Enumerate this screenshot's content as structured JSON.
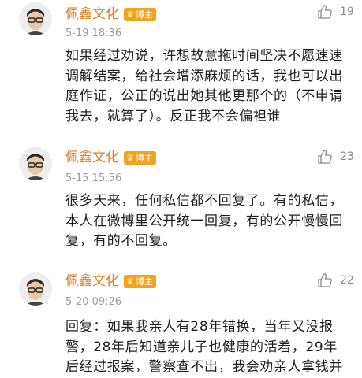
{
  "comments": [
    {
      "username": "佩鑫文化",
      "badge": "博主",
      "time": "5-19 18:36",
      "likes": "19",
      "lines": [
        "如果经过劝说，许想故意拖时间坚决不愿速速",
        "调解结案，给社会增添麻烦的话，我也可以出",
        "庭作证，公正的说出她其他更那个的（不申请",
        "我去，就算了）。反正我不会偏袒谁"
      ]
    },
    {
      "username": "佩鑫文化",
      "badge": "博主",
      "time": "5-15 15:56",
      "likes": "23",
      "lines": [
        "很多天来，任何私信都不回复了。有的私信，",
        "本人在微博里公开统一回复，有的公开慢慢回",
        "复，有的不回复。"
      ]
    },
    {
      "username": "佩鑫文化",
      "badge": "博主",
      "time": "5-20 09:26",
      "likes": "22",
      "lines": [
        "回复：如果我亲人有28年错换，当年又没报",
        "警，28年后知道亲儿子也健康的活着，29年",
        "后经过报案，警察查不出，我会劝亲人拿钱并"
      ]
    }
  ],
  "icons": {
    "avatar": "avatar-man-glasses",
    "like": "thumbs-up-icon",
    "badge": "crown-icon"
  },
  "colors": {
    "username": "#d9822b",
    "badge": "#f2a21d",
    "timestamp": "#9a9a9a",
    "text": "#1e1e1e"
  }
}
